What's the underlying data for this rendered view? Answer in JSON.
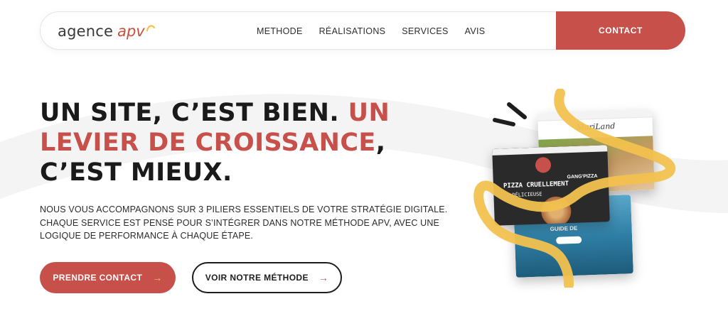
{
  "brand": {
    "word": "agence",
    "accent": "apv",
    "accent_color": "#c8504a",
    "mark_color": "#f2c14e"
  },
  "nav": {
    "links": [
      "METHODE",
      "RÉALISATIONS",
      "SERVICES",
      "AVIS"
    ],
    "contact_label": "CONTACT"
  },
  "hero": {
    "headline_part1": "UN SITE, C’EST BIEN. ",
    "headline_accent": "UN LEVIER DE CROISSANCE",
    "headline_part2": ", C’EST MIEUX.",
    "subtext": "NOUS VOUS ACCOMPAGNONS SUR 3 PILIERS ESSENTIELS DE VOTRE STRATÉGIE DIGITALE. CHAQUE SERVICE EST PENSÉ POUR S’INTÉGRER DANS NOTRE MÉTHODE APV, AVEC UNE LOGIQUE DE PERFORMANCE À CHAQUE ÉTAPE.",
    "primary_button": "PRENDRE CONTACT",
    "secondary_button": "VOIR NOTRE MÉTHODE",
    "arrow_glyph": "→"
  },
  "illustration": {
    "pizza_line1": "PIZZA CRUELLEMENT",
    "pizza_line2": "DÉLICIEUSE",
    "pizza_brand": "GANG'PIZZA",
    "sea_label": "GUIDE DE",
    "script_logo": "MariLand"
  },
  "colors": {
    "accent": "#c8504a",
    "yellow": "#f2c14e",
    "dark": "#1d1d1d"
  }
}
